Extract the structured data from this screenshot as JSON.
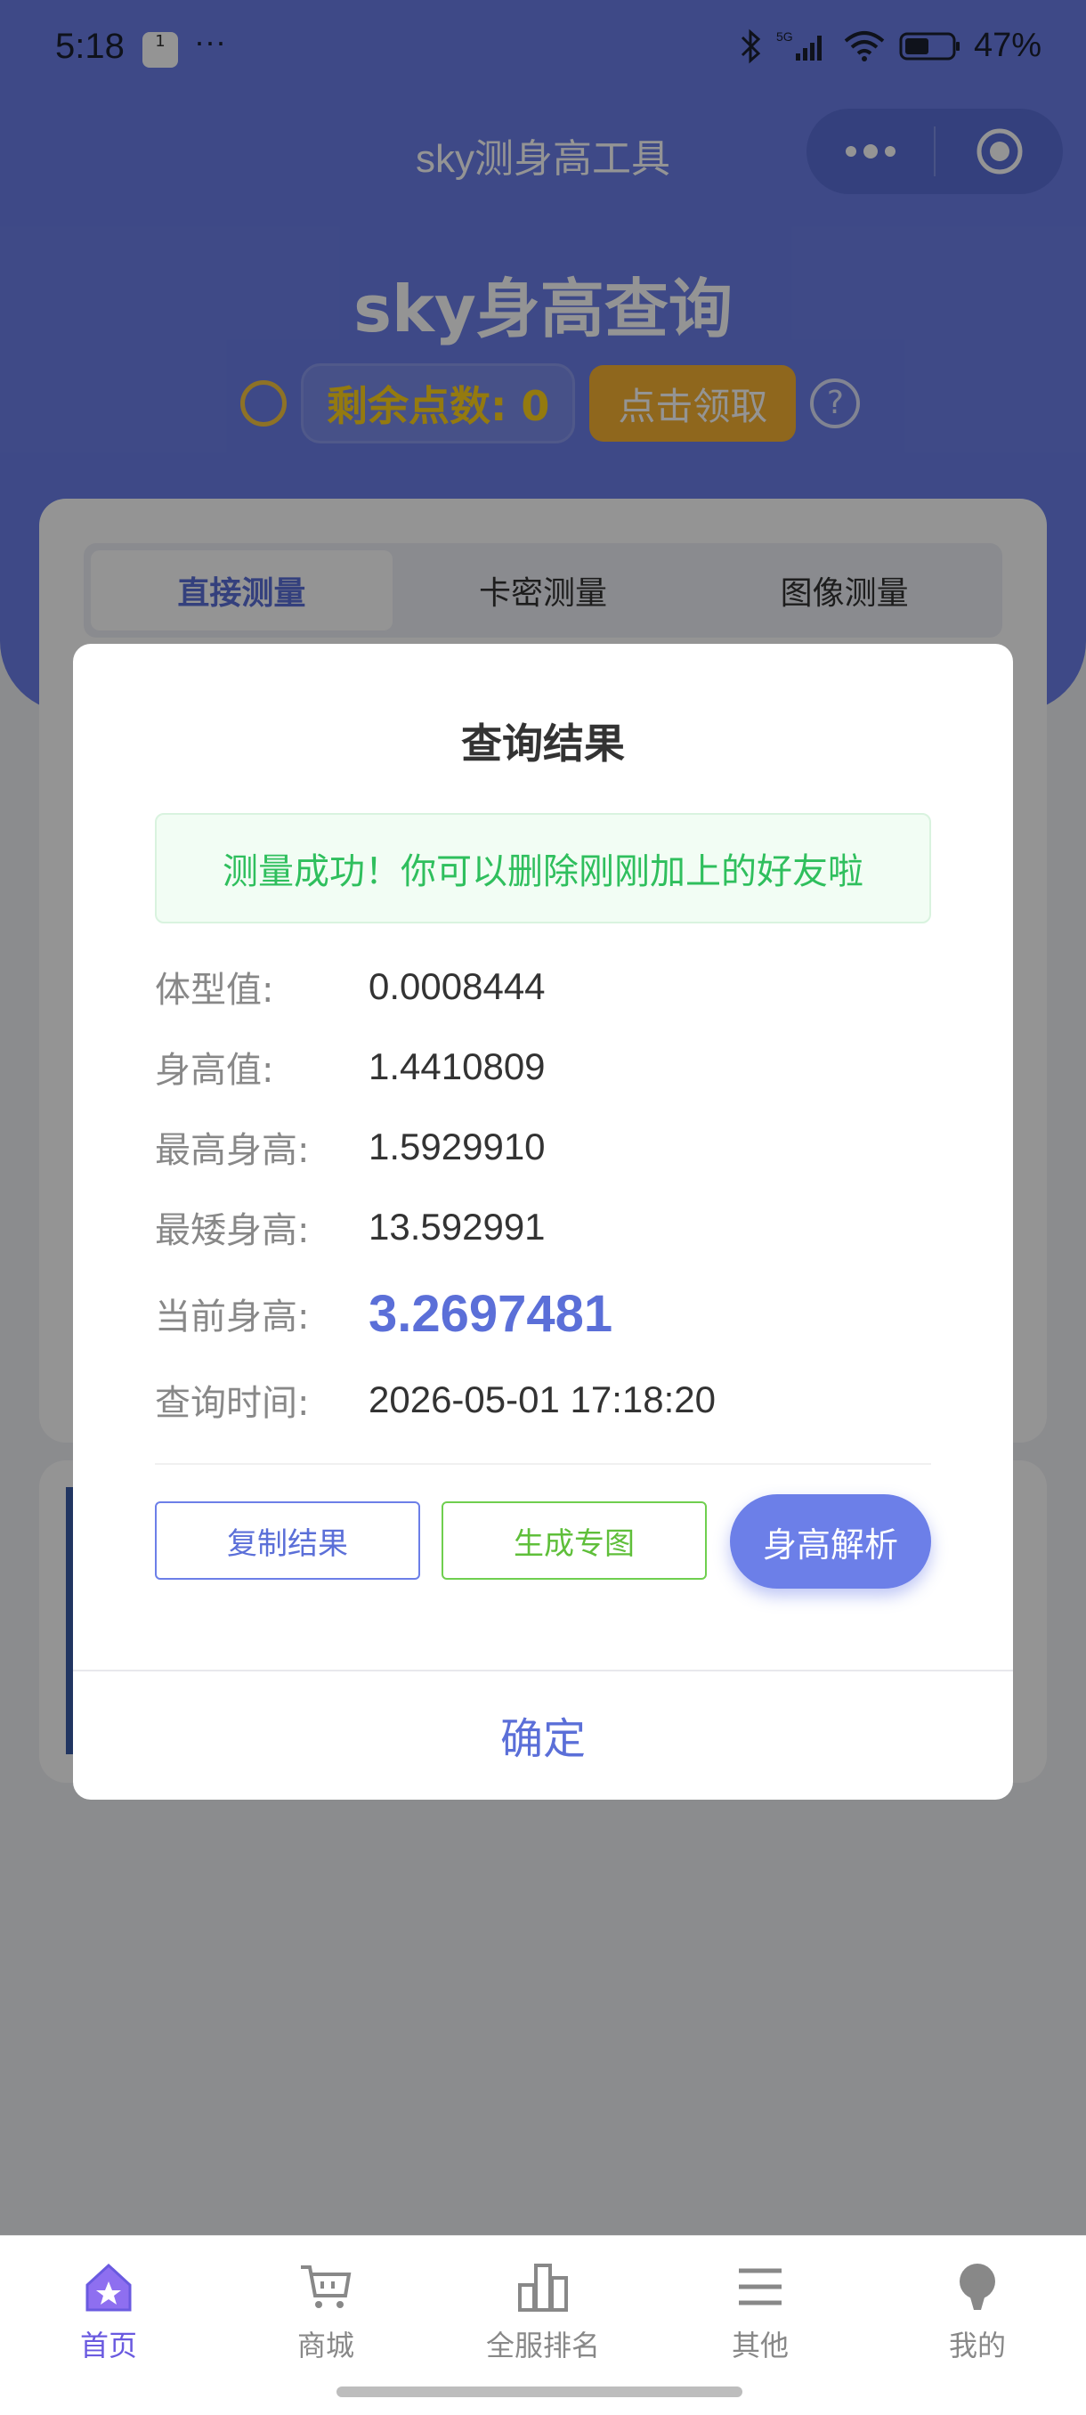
{
  "status_bar": {
    "time": "5:18",
    "notif_badge": "1",
    "more": "···",
    "battery_pct": "47%"
  },
  "nav": {
    "title": "sky测身高工具"
  },
  "header": {
    "title": "sky身高查询",
    "points_label": "剩余点数: 0",
    "claim_button": "点击领取",
    "help": "?"
  },
  "tabs": [
    {
      "label": "直接测量"
    },
    {
      "label": "卡密测量"
    },
    {
      "label": "图像测量"
    }
  ],
  "dialog": {
    "title": "查询结果",
    "success_message": "测量成功！你可以删除刚刚加上的好友啦",
    "rows": [
      {
        "label": "体型值:",
        "value": "0.0008444"
      },
      {
        "label": "身高值:",
        "value": "1.4410809"
      },
      {
        "label": "最高身高:",
        "value": "1.5929910"
      },
      {
        "label": "最矮身高:",
        "value": "13.592991"
      },
      {
        "label": "当前身高:",
        "value": "3.2697481"
      },
      {
        "label": "查询时间:",
        "value": "2026-05-01 17:18:20"
      }
    ],
    "buttons": {
      "copy": "复制结果",
      "generate": "生成专图",
      "analyze": "身高解析"
    },
    "confirm": "确定"
  },
  "tabbar": [
    {
      "label": "首页",
      "icon": "home-icon"
    },
    {
      "label": "商城",
      "icon": "cart-icon"
    },
    {
      "label": "全服排名",
      "icon": "ranking-icon"
    },
    {
      "label": "其他",
      "icon": "menu-icon"
    },
    {
      "label": "我的",
      "icon": "profile-icon"
    }
  ],
  "colors": {
    "brand": "#6c7fe8",
    "success": "#2fbf5d",
    "accent_gold": "#ffd31a",
    "claim": "#f6b133",
    "active_tab": "#6a5ae0"
  }
}
